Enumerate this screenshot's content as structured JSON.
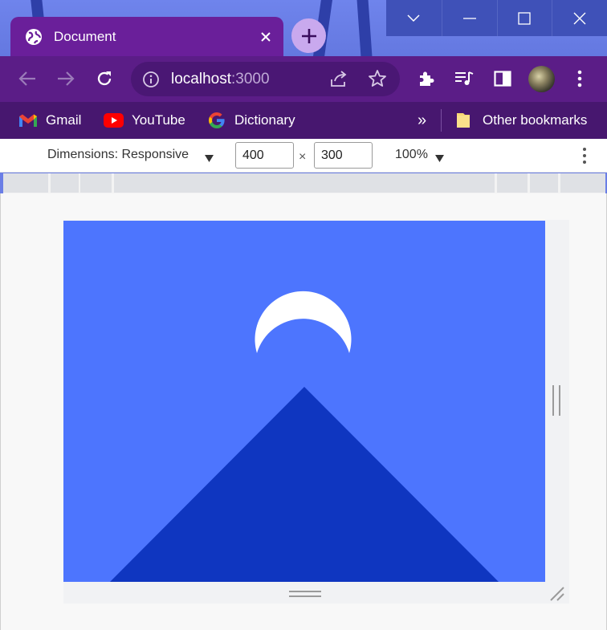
{
  "browser": {
    "tab": {
      "title": "Document",
      "icon": "globe-icon"
    },
    "window_controls": [
      "tab-search-icon",
      "minimize-icon",
      "maximize-icon",
      "close-icon"
    ],
    "address_bar": {
      "host": "localhost",
      "port": ":3000",
      "icon": "info-icon"
    },
    "toolbar_icons": [
      "extensions-icon",
      "media-controls-icon",
      "side-panel-icon",
      "profile-avatar",
      "menu-icon"
    ],
    "bookmarks": [
      {
        "label": "Gmail",
        "icon": "gmail-icon"
      },
      {
        "label": "YouTube",
        "icon": "youtube-icon"
      },
      {
        "label": "Dictionary",
        "icon": "google-icon"
      }
    ],
    "bookmarks_overflow": "»",
    "other_bookmarks": {
      "label": "Other bookmarks",
      "icon": "folder-icon"
    }
  },
  "devtools": {
    "dimensions_label": "Dimensions: Responsive",
    "width": "400",
    "times": "×",
    "height": "300",
    "zoom": "100%"
  },
  "page_content": {
    "background_color": "#4d75fe",
    "moon_color": "#ffffff",
    "mountain_color": "#0f36c0"
  }
}
